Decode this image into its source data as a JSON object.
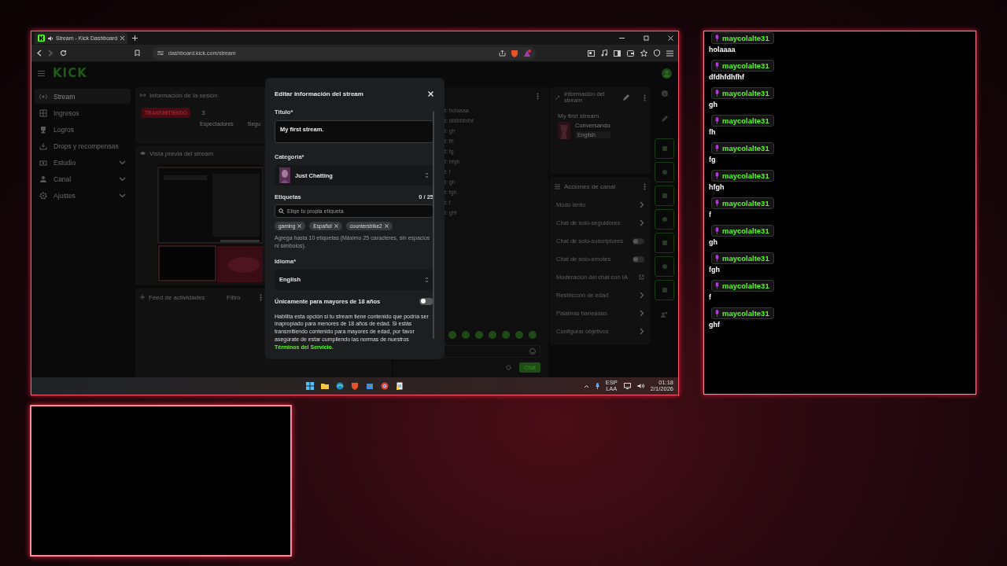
{
  "browser": {
    "tab_title": "Stream - Kick Dashboard",
    "url": "dashboard.kick.com/stream"
  },
  "header": {
    "logo": "KICK"
  },
  "sidebar": [
    {
      "label": "Stream",
      "kind": "link",
      "selected": true
    },
    {
      "label": "Ingresos",
      "kind": "link",
      "selected": false
    },
    {
      "label": "Logros",
      "kind": "link",
      "selected": false
    },
    {
      "label": "Drops y recompensas",
      "kind": "link",
      "selected": false
    },
    {
      "label": "Estudio",
      "kind": "group",
      "selected": false
    },
    {
      "label": "Canal",
      "kind": "group",
      "selected": false
    },
    {
      "label": "Ajustes",
      "kind": "group",
      "selected": false
    }
  ],
  "session": {
    "title": "Información de la sesión",
    "status": "TRANSMITIENDO",
    "viewers": "3",
    "stats": [
      "Espectadores",
      "Segu"
    ],
    "preview_title": "Vista previa del stream"
  },
  "feed": {
    "title": "Feed de actividades",
    "filter": "Filtro"
  },
  "stream_chat": {
    "lines": [
      "t: holaaaa",
      "t: dfdhfdhfhf",
      "t: gh",
      "t: fh",
      "t: fg",
      "t: hfgh",
      "t: f",
      "t: gh",
      "t: fgh",
      "t: f",
      "t: ghf"
    ],
    "send": "Chat"
  },
  "stream_info": {
    "title": "Información del stream",
    "stream_title": "My first stream.",
    "category": "Conversando",
    "language": "English"
  },
  "channel_actions": {
    "title": "Acciones de canal",
    "items": [
      {
        "label": "Modo lento",
        "kind": "arrow"
      },
      {
        "label": "Chat de solo-seguidores",
        "kind": "arrow"
      },
      {
        "label": "Chat de solo-suscriptores",
        "kind": "toggle",
        "on": false
      },
      {
        "label": "Chat de solo-emotes",
        "kind": "toggle",
        "on": false
      },
      {
        "label": "Moderación del chat con IA",
        "kind": "external"
      },
      {
        "label": "Restricción de edad",
        "kind": "arrow"
      },
      {
        "label": "Palabras baneadas",
        "kind": "arrow"
      },
      {
        "label": "Configurar objetivos",
        "kind": "arrow"
      }
    ]
  },
  "modal": {
    "title": "Editar información del stream",
    "title_label": "Título*",
    "title_value": "My first stream.",
    "category_label": "Categoría*",
    "category": "Just Chatting",
    "tags_label": "Etiquetas",
    "tags_count": "0 / 25",
    "tags_placeholder": "Elige tu propia etiqueta",
    "tags": [
      "gaming",
      "Español",
      "counterstrike2"
    ],
    "tags_help": "Agrega hasta 10 etiquetas (Máximo 25 caracteres, sin espacios ni símbolos).",
    "language_label": "Idioma*",
    "language": "English",
    "adult_label": "Únicamente para mayores de 18 años",
    "adult_on": false,
    "adult_help": "Habilita esta opción si tu stream tiene contenido que podría ser inapropiado para menores de 18 años de edad. Si estás transmitiendo contenido para mayores de edad, por favor asegúrate de estar cumpliendo las normas de nuestros",
    "terms_link": "Términos del Servicio."
  },
  "taskbar": {
    "language": "ESP",
    "region": "LAA",
    "time": "01:18",
    "date": "2/1/2026"
  },
  "overlay_chat": {
    "messages": [
      {
        "user": "maycolalte31",
        "text": "holaaaa"
      },
      {
        "user": "maycolalte31",
        "text": "dfdhfdhfhf"
      },
      {
        "user": "maycolalte31",
        "text": "gh"
      },
      {
        "user": "maycolalte31",
        "text": "fh"
      },
      {
        "user": "maycolalte31",
        "text": "fg"
      },
      {
        "user": "maycolalte31",
        "text": "hfgh"
      },
      {
        "user": "maycolalte31",
        "text": "f"
      },
      {
        "user": "maycolalte31",
        "text": "gh"
      },
      {
        "user": "maycolalte31",
        "text": "fgh"
      },
      {
        "user": "maycolalte31",
        "text": "f"
      },
      {
        "user": "maycolalte31",
        "text": "ghf"
      }
    ]
  }
}
